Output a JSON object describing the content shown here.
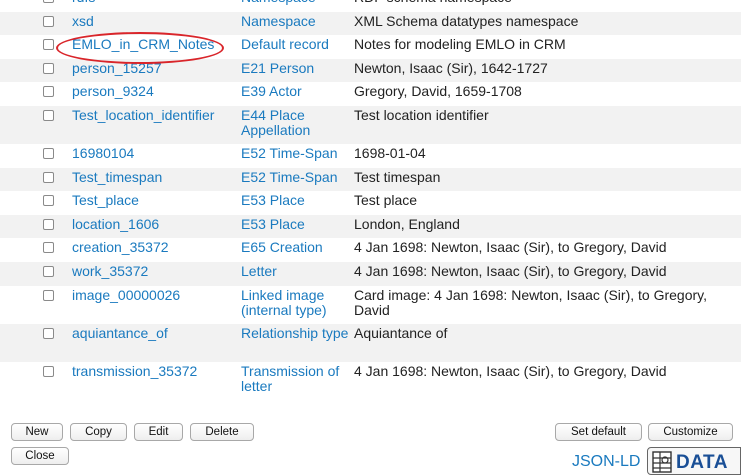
{
  "records": [
    {
      "id": "rdfs",
      "type": "Namespace",
      "description": "RDF schema namespace"
    },
    {
      "id": "xsd",
      "type": "Namespace",
      "description": "XML Schema datatypes namespace"
    },
    {
      "id": "EMLO_in_CRM_Notes",
      "type": "Default record",
      "description": "Notes for modeling EMLO in CRM"
    },
    {
      "id": "person_15257",
      "type": "E21 Person",
      "description": "Newton, Isaac (Sir), 1642-1727"
    },
    {
      "id": "person_9324",
      "type": "E39 Actor",
      "description": "Gregory, David, 1659-1708"
    },
    {
      "id": "Test_location_identifier",
      "type": "E44 Place Appellation",
      "description": "Test location identifier"
    },
    {
      "id": "16980104",
      "type": "E52 Time-Span",
      "description": "1698-01-04"
    },
    {
      "id": "Test_timespan",
      "type": "E52 Time-Span",
      "description": "Test timespan"
    },
    {
      "id": "Test_place",
      "type": "E53 Place",
      "description": "Test place"
    },
    {
      "id": "location_1606",
      "type": "E53 Place",
      "description": "London, England"
    },
    {
      "id": "creation_35372",
      "type": "E65 Creation",
      "description": "4 Jan 1698: Newton, Isaac (Sir), to Gregory, David"
    },
    {
      "id": "work_35372",
      "type": "Letter",
      "description": "4 Jan 1698: Newton, Isaac (Sir), to Gregory, David"
    },
    {
      "id": "image_00000026",
      "type": "Linked image (internal type)",
      "description": "Card image: 4 Jan 1698: Newton, Isaac (Sir), to Gregory, David"
    },
    {
      "id": "aquiantance_of",
      "type": "Relationship type",
      "description": "Aquiantance of"
    },
    {
      "id": "transmission_35372",
      "type": "Transmission of letter",
      "description": "4 Jan 1698: Newton, Isaac (Sir), to Gregory, David"
    }
  ],
  "buttons": {
    "new": "New",
    "copy": "Copy",
    "edit": "Edit",
    "delete": "Delete",
    "close": "Close",
    "set_default": "Set default",
    "customize": "Customize"
  },
  "footer": {
    "json_ld": "JSON-LD",
    "data_badge": "DATA"
  },
  "annotation_color": "#d9252a",
  "link_color": "#1a7abf"
}
